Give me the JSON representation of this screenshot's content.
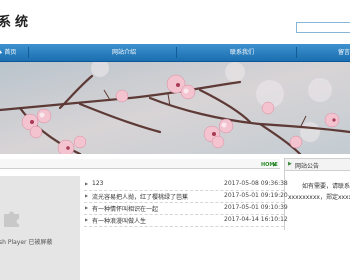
{
  "header": {
    "site_title": "系统",
    "search": {
      "value": "",
      "placeholder": ""
    }
  },
  "nav": {
    "items": [
      {
        "label": "首页",
        "icon": "home-icon"
      },
      {
        "label": "网站介绍"
      },
      {
        "label": "联系我们"
      },
      {
        "label": "留言"
      }
    ]
  },
  "banner": {
    "description_colors": {
      "petal": "#f4c6d0",
      "branch": "#6b3f3a",
      "sky": "#c9d3d9"
    }
  },
  "main": {
    "home_link": "HOME",
    "flash_notice": "sh Player 已被屏蔽",
    "news": [
      {
        "title": "123",
        "date": "2017-05-08 09:36:38"
      },
      {
        "title": "流光容易把人抛，红了樱桃绿了芭蕉",
        "date": "2017-05-01 09:19:20"
      },
      {
        "title": "有一种情怀叫相识在一起",
        "date": "2017-05-01 09:10:39"
      },
      {
        "title": "有一种浪漫叫做人生",
        "date": "2017-04-14 16:10:12"
      }
    ]
  },
  "notice": {
    "title": "网站公告",
    "text_line1": "如有需要，请联系",
    "text_line2": "xxxxxxxxx，郑定xxxxxxx"
  },
  "colors": {
    "nav_bg": "#1b6fb0",
    "accent_green": "#2c8a2c"
  }
}
